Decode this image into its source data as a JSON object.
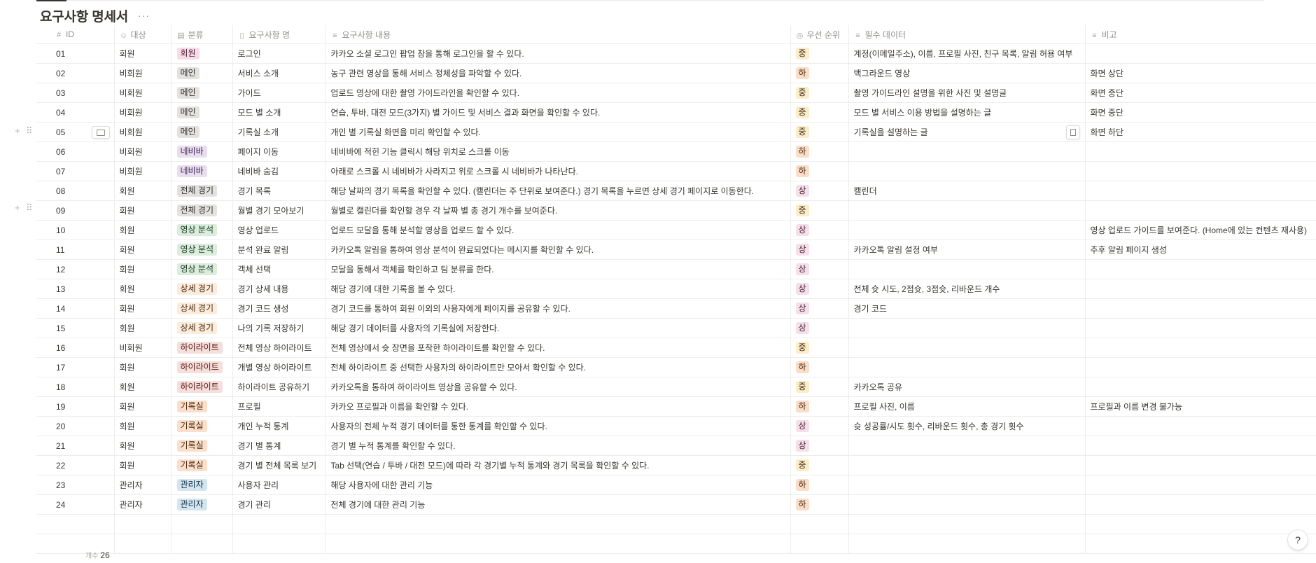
{
  "database": {
    "title": "요구사항 명세서",
    "more_label": "···"
  },
  "columns": [
    {
      "label": "ID",
      "icon": "#"
    },
    {
      "label": "대상",
      "icon": "person"
    },
    {
      "label": "분류",
      "icon": "select"
    },
    {
      "label": "요구사항 명",
      "icon": "book"
    },
    {
      "label": "요구사항 내용",
      "icon": "text"
    },
    {
      "label": "우선 순위",
      "icon": "status"
    },
    {
      "label": "필수 데이터",
      "icon": "text"
    },
    {
      "label": "비고",
      "icon": "text"
    }
  ],
  "colors": {
    "회원": {
      "bg": "#f7dbe6",
      "fg": "#4c2337"
    },
    "메인": {
      "bg": "#e3e2e0",
      "fg": "#32302c"
    },
    "네비바": {
      "bg": "#e8deee",
      "fg": "#412454"
    },
    "전체 경기": {
      "bg": "#e3e2e0",
      "fg": "#32302c"
    },
    "영상 분석": {
      "bg": "#dbeddb",
      "fg": "#1c3829"
    },
    "상세 경기": {
      "bg": "#fbecdd",
      "fg": "#49290e"
    },
    "하이라이트": {
      "bg": "#f4dfdb",
      "fg": "#5d1715"
    },
    "기록실": {
      "bg": "#fbdfca",
      "fg": "#49290e"
    },
    "관리자": {
      "bg": "#d3e5ef",
      "fg": "#183347"
    },
    "상": {
      "bg": "#f5e0e9",
      "fg": "#4c2337"
    },
    "중": {
      "bg": "#fdecc8",
      "fg": "#402c1b"
    },
    "하": {
      "bg": "#fadec9",
      "fg": "#49290e"
    }
  },
  "rows": [
    {
      "id": "01",
      "target": "회원",
      "category": "회원",
      "name": "로그인",
      "content": "카카오 소셜 로그인 팝업 창을 통해 로그인을 할 수 있다.",
      "priority": "중",
      "data": "계정(이메일주소), 이름, 프로필 사진, 친구 목록, 알림 허용 여부",
      "note": ""
    },
    {
      "id": "02",
      "target": "비회원",
      "category": "메인",
      "name": "서비스 소개",
      "content": "농구 관련 영상을 통해 서비스 정체성을 파악할 수 있다.",
      "priority": "하",
      "data": "백그라운드 영상",
      "note": "화면 상단"
    },
    {
      "id": "03",
      "target": "비회원",
      "category": "메인",
      "name": "가이드",
      "content": "업로드 영상에 대한 촬영 가이드라인을 확인할 수 있다.",
      "priority": "중",
      "data": "촬영 가이드라인 설명을 위한 사진 및 설명글",
      "note": "화면 중단"
    },
    {
      "id": "04",
      "target": "비회원",
      "category": "메인",
      "name": "모드 별 소개",
      "content": "연습, 투바, 대전 모드(3가지) 별 가이드 및 서비스 결과 화면을 확인할 수 있다.",
      "priority": "중",
      "data": "모드 별 서비스 이용 방법을 설명하는 글",
      "note": "화면 중단"
    },
    {
      "id": "05",
      "target": "비회원",
      "category": "메인",
      "name": "기록실 소개",
      "content": "개인 별 기록실 화면을 미리 확인할 수 있다.",
      "priority": "중",
      "data": "기록실을 설명하는 글",
      "note": "화면 하단"
    },
    {
      "id": "06",
      "target": "비회원",
      "category": "네비바",
      "name": "페이지 이동",
      "content": "네비바에 적힌 기능 클릭시 해당 위치로 스크롤 이동",
      "priority": "하",
      "data": "",
      "note": ""
    },
    {
      "id": "07",
      "target": "비회원",
      "category": "네비바",
      "name": "네비바 숨김",
      "content": "아래로 스크롤 시 네비바가 사라지고 위로 스크롤 시 네비바가 나타난다.",
      "priority": "하",
      "data": "",
      "note": ""
    },
    {
      "id": "08",
      "target": "회원",
      "category": "전체 경기",
      "name": "경기 목록",
      "content": "해당 날짜의 경기 목록을 확인할 수 있다. (캘린더는 주 단위로 보여준다.) 경기 목록을 누르면 상세 경기 페이지로 이동한다.",
      "priority": "상",
      "data": "캘린더",
      "note": ""
    },
    {
      "id": "09",
      "target": "회원",
      "category": "전체 경기",
      "name": "월별 경기 모아보기",
      "content": "월별로 캘린더를 확인할 경우 각 날짜 별 총 경기 개수를 보여준다.",
      "priority": "중",
      "data": "",
      "note": ""
    },
    {
      "id": "10",
      "target": "회원",
      "category": "영상 분석",
      "name": "영상 업로드",
      "content": "업로드 모달을 통해 분석할 영상을 업로드 할 수 있다.",
      "priority": "상",
      "data": "",
      "note": "영상 업로드 가이드를 보여준다. (Home에 있는 컨텐츠 재사용)"
    },
    {
      "id": "11",
      "target": "회원",
      "category": "영상 분석",
      "name": "분석 완료 알림",
      "content": "카카오톡 알림을 통하여 영상 분석이 완료되었다는 메시지를 확인할 수 있다.",
      "priority": "상",
      "data": "카카오톡 알림 설정 여부",
      "note": "추후 알림 페이지 생성"
    },
    {
      "id": "12",
      "target": "회원",
      "category": "영상 분석",
      "name": "객체 선택",
      "content": "모달을 통해서 객체를 확인하고 팀 분류를 한다.",
      "priority": "상",
      "data": "",
      "note": ""
    },
    {
      "id": "13",
      "target": "회원",
      "category": "상세 경기",
      "name": "경기 상세 내용",
      "content": "해당 경기에 대한 기록을 볼 수 있다.",
      "priority": "상",
      "data": "전체 슛 시도, 2점슛, 3점슛, 리바운드 개수",
      "note": ""
    },
    {
      "id": "14",
      "target": "회원",
      "category": "상세 경기",
      "name": "경기 코드 생성",
      "content": "경기 코드를 통하여 회원 이외의 사용자에게 페이지를 공유할 수 있다.",
      "priority": "상",
      "data": "경기 코드",
      "note": ""
    },
    {
      "id": "15",
      "target": "회원",
      "category": "상세 경기",
      "name": "나의 기록 저장하기",
      "content": "해당 경기 데이터를 사용자의 기록실에 저장한다.",
      "priority": "상",
      "data": "",
      "note": ""
    },
    {
      "id": "16",
      "target": "비회원",
      "category": "하이라이트",
      "name": "전체 영상 하이라이트",
      "content": "전체 영상에서 슛 장면을 포착한 하이라이트를 확인할 수 있다.",
      "priority": "중",
      "data": "",
      "note": ""
    },
    {
      "id": "17",
      "target": "회원",
      "category": "하이라이트",
      "name": "개별 영상 하이라이트",
      "content": "전체 하이라이트 중 선택한 사용자의 하이라이트만 모아서 확인할 수 있다.",
      "priority": "하",
      "data": "",
      "note": ""
    },
    {
      "id": "18",
      "target": "회원",
      "category": "하이라이트",
      "name": "하이라이트 공유하기",
      "content": "카카오톡을 통하여 하이라이트 영상을 공유할 수 있다.",
      "priority": "중",
      "data": "카카오톡 공유",
      "note": ""
    },
    {
      "id": "19",
      "target": "회원",
      "category": "기록실",
      "name": "프로필",
      "content": "카카오 프로필과 이름을 확인할 수 있다.",
      "priority": "하",
      "data": "프로필 사진, 이름",
      "note": "프로필과 이름 변경 불가능"
    },
    {
      "id": "20",
      "target": "회원",
      "category": "기록실",
      "name": "개인 누적 통계",
      "content": "사용자의 전체 누적 경기 데이터를 통한 통계를 확인할 수 있다.",
      "priority": "상",
      "data": "슛 성공률/시도 횟수, 리바운드 횟수, 총 경기 횟수",
      "note": ""
    },
    {
      "id": "21",
      "target": "회원",
      "category": "기록실",
      "name": "경기 별 통계",
      "content": "경기 별 누적 통계를 확인할 수 있다.",
      "priority": "상",
      "data": "",
      "note": ""
    },
    {
      "id": "22",
      "target": "회원",
      "category": "기록실",
      "name": "경기 별 전체 목록 보기",
      "content": "Tab 선택(연습 / 투바 / 대전 모드)에 따라 각 경기별 누적 통계와 경기 목록을 확인할 수 있다.",
      "priority": "중",
      "data": "",
      "note": ""
    },
    {
      "id": "23",
      "target": "관리자",
      "category": "관리자",
      "name": "사용자 관리",
      "content": "해당 사용자에 대한 관리 기능",
      "priority": "하",
      "data": "",
      "note": ""
    },
    {
      "id": "24",
      "target": "관리자",
      "category": "관리자",
      "name": "경기 관리",
      "content": "전체 경기에 대한 관리 기능",
      "priority": "하",
      "data": "",
      "note": ""
    }
  ],
  "footer": {
    "count_label": "개수",
    "count_value": "26"
  },
  "help_label": "?",
  "row_handles": {
    "add": "+",
    "drag": "⠿"
  }
}
